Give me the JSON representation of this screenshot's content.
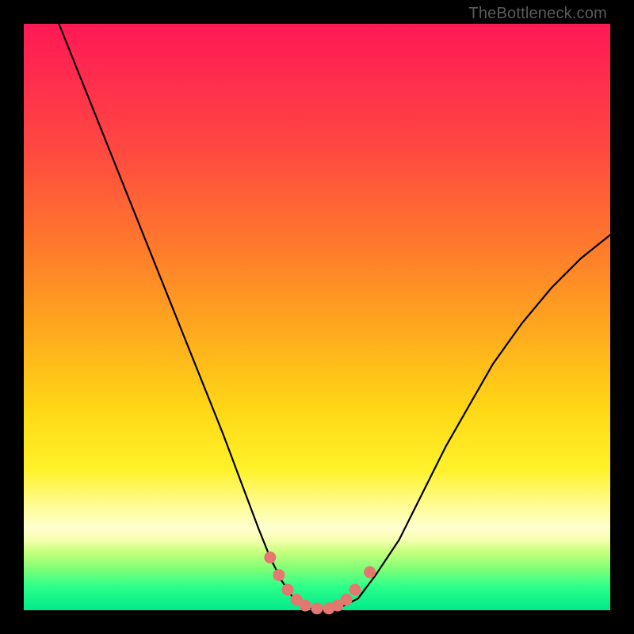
{
  "watermark": "TheBottleneck.com",
  "colors": {
    "curve_stroke": "#000000",
    "marker_fill": "#e4776f",
    "marker_stroke": "#e4776f"
  },
  "chart_data": {
    "type": "line",
    "title": "",
    "xlabel": "",
    "ylabel": "",
    "xlim": [
      0,
      100
    ],
    "ylim": [
      0,
      100
    ],
    "series": [
      {
        "name": "bottleneck-curve",
        "x": [
          6,
          10,
          14,
          18,
          22,
          26,
          30,
          34,
          37,
          40,
          42,
          44,
          46,
          48,
          50,
          52,
          54,
          57,
          60,
          64,
          68,
          72,
          76,
          80,
          85,
          90,
          95,
          100
        ],
        "y": [
          100,
          90,
          80,
          70,
          60,
          50,
          40,
          30,
          22,
          14,
          9,
          5,
          2,
          0.5,
          0,
          0,
          0.5,
          2,
          6,
          12,
          20,
          28,
          35,
          42,
          49,
          55,
          60,
          64
        ]
      }
    ],
    "markers": [
      {
        "x": 42.0,
        "y": 9.0
      },
      {
        "x": 43.5,
        "y": 6.0
      },
      {
        "x": 45.0,
        "y": 3.5
      },
      {
        "x": 46.5,
        "y": 1.8
      },
      {
        "x": 48.0,
        "y": 0.8
      },
      {
        "x": 50.0,
        "y": 0.3
      },
      {
        "x": 52.0,
        "y": 0.3
      },
      {
        "x": 53.5,
        "y": 0.8
      },
      {
        "x": 55.0,
        "y": 1.8
      },
      {
        "x": 56.5,
        "y": 3.5
      },
      {
        "x": 59.0,
        "y": 6.5
      }
    ],
    "marker_radius_px": 7
  }
}
